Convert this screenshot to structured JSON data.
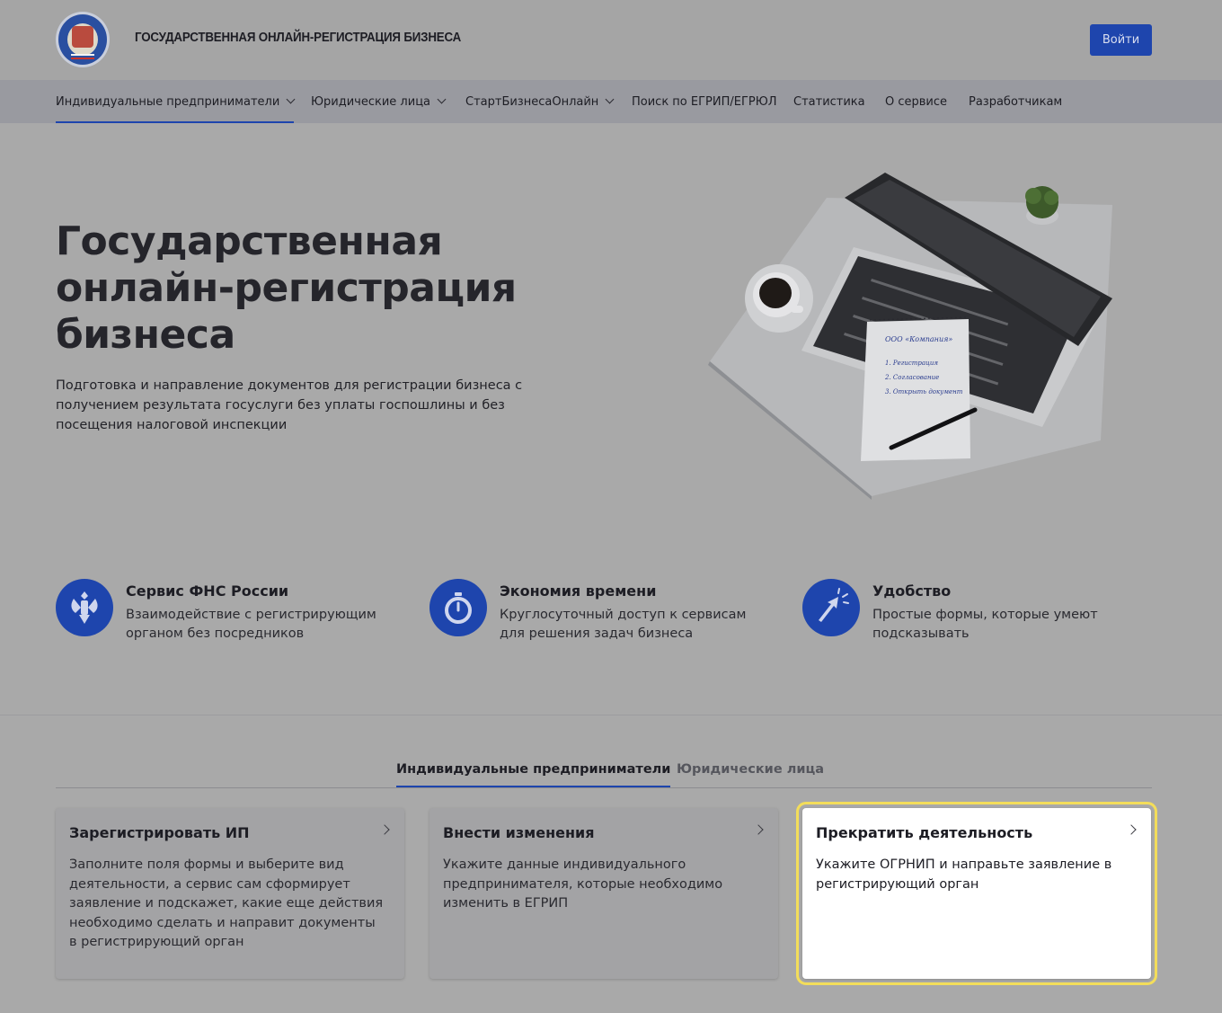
{
  "header": {
    "brand": "ГОСУДАРСТВЕННАЯ ОНЛАЙН-РЕГИСТРАЦИЯ БИЗНЕСА",
    "login_label": "Войти"
  },
  "nav": {
    "items": [
      {
        "label": "Индивидуальные предприниматели",
        "dropdown": true,
        "active": true
      },
      {
        "label": "Юридические лица",
        "dropdown": true
      },
      {
        "label": "СтартБизнесаОнлайн",
        "dropdown": true
      },
      {
        "label": "Поиск по ЕГРИП/ЕГРЮЛ"
      },
      {
        "label": "Статистика"
      },
      {
        "label": "О сервисе"
      },
      {
        "label": "Разработчикам"
      }
    ]
  },
  "hero": {
    "title_lines": [
      "Государственная",
      "онлайн-регистрация",
      "бизнеса"
    ],
    "subtitle": "Подготовка и направление документов для регистрации бизнеса с получением результата госуслуги без уплаты госпошлины и без посещения налоговой инспекции",
    "notepad_lines": [
      "ООО «Компания»",
      "1. Регистрация",
      "2. Согласование",
      "3. Открыть документ"
    ]
  },
  "features": [
    {
      "icon": "eagle-emblem-icon",
      "title": "Сервис ФНС России",
      "desc": "Взаимодействие с регистрирующим органом без посредников"
    },
    {
      "icon": "stopwatch-icon",
      "title": "Экономия времени",
      "desc": "Круглосуточный доступ к сервисам для решения задач бизнеса"
    },
    {
      "icon": "cursor-click-icon",
      "title": "Удобство",
      "desc": "Простые формы, которые умеют подсказывать"
    }
  ],
  "tabs": [
    {
      "label": "Индивидуальные предприниматели",
      "active": true
    },
    {
      "label": "Юридические лица",
      "active": false
    }
  ],
  "cards": [
    {
      "title": "Зарегистрировать ИП",
      "desc": "Заполните поля формы и выберите вид деятельности, а сервис сам сформирует заявление и подскажет, какие еще действия необходимо сделать и направит документы в регистрирующий орган"
    },
    {
      "title": "Внести изменения",
      "desc": "Укажите данные индивидуального предпринимателя, которые необходимо изменить в ЕГРИП"
    },
    {
      "title": "Прекратить деятельность",
      "desc": "Укажите ОГРНИП и направьте заявление в регистрирующий орган",
      "highlighted": true
    }
  ],
  "colors": {
    "accent": "#1e45ad",
    "highlight_outline": "#f3dd5a"
  }
}
